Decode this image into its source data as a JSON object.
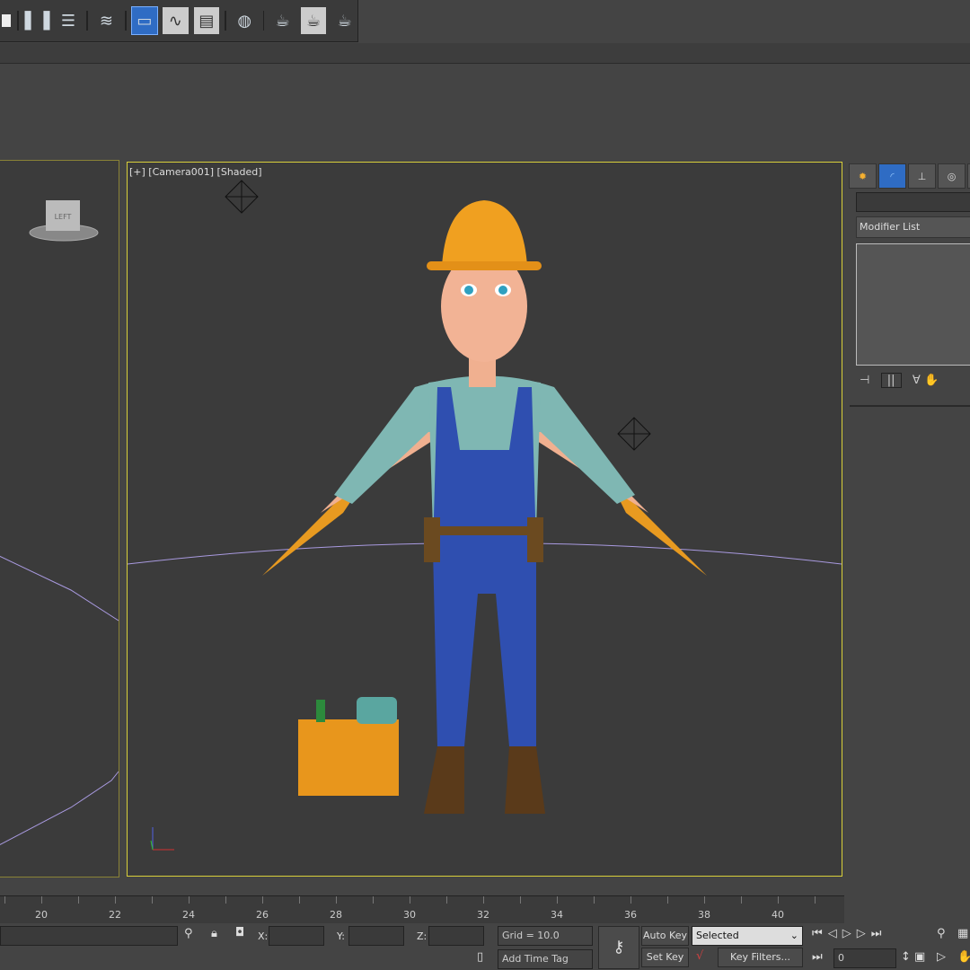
{
  "toolbar": {
    "icons": [
      "checkbox-icon",
      "mirror-icon",
      "align-icon",
      "layer-manager-icon",
      "scene-explorer-icon",
      "curve-editor-icon",
      "schematic-view-icon",
      "material-editor-icon",
      "render-setup-icon",
      "rendered-frame-icon",
      "render-icon"
    ],
    "active": "scene-explorer-icon"
  },
  "viewport": {
    "label": "[+] [Camera001] [Shaded]",
    "left_viewcube": "LEFT"
  },
  "command_panel": {
    "modifier_list": "Modifier List",
    "name_value": ""
  },
  "timeline": {
    "ticks": [
      "20",
      "22",
      "24",
      "26",
      "28",
      "30",
      "32",
      "34",
      "36",
      "38",
      "40"
    ]
  },
  "status": {
    "x_label": "X:",
    "y_label": "Y:",
    "z_label": "Z:",
    "grid": "Grid = 10.0",
    "add_time_tag": "Add Time Tag",
    "auto_key": "Auto Key",
    "set_key": "Set Key",
    "selected": "Selected",
    "key_filters": "Key Filters...",
    "frame": "0"
  },
  "colors": {
    "active_viewport_border": "#d8cf3a",
    "accent": "#2f6cc4"
  }
}
